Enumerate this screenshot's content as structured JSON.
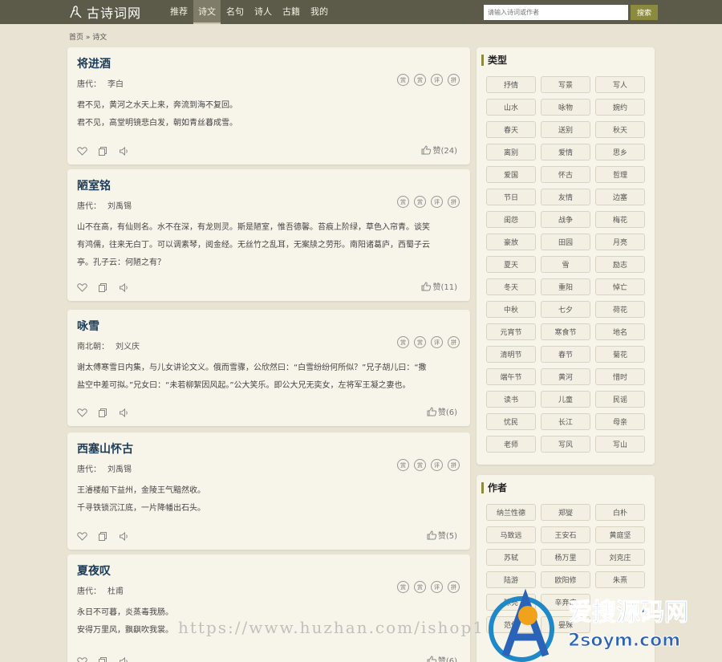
{
  "header": {
    "logo_text": "古诗词网",
    "nav": [
      "推荐",
      "诗文",
      "名句",
      "诗人",
      "古籍",
      "我的"
    ],
    "search_placeholder": "请输入诗词或作者",
    "search_button": "搜索"
  },
  "breadcrumb": {
    "home": "首页",
    "sep": "»",
    "current": "诗文"
  },
  "actions": [
    "赏",
    "赏",
    "评",
    "拼"
  ],
  "cards": [
    {
      "title": "将进酒",
      "dynasty": "唐代：",
      "author": "李白",
      "lines": [
        "君不见，黄河之水天上来，奔流到海不复回。",
        "君不见，高堂明镜悲白发，朝如青丝暮成雪。"
      ],
      "likes": "赞(24)"
    },
    {
      "title": "陋室铭",
      "dynasty": "唐代：",
      "author": "刘禹锡",
      "lines": [
        "山不在高，有仙则名。水不在深，有龙则灵。斯是陋室，惟吾德馨。苔痕上阶绿，草色入帘青。谈笑",
        "有鸿儒，往来无白丁。可以调素琴，阅金经。无丝竹之乱耳，无案牍之劳形。南阳诸葛庐，西蜀子云",
        "亭。孔子云：何陋之有？"
      ],
      "likes": "赞(11)"
    },
    {
      "title": "咏雪",
      "dynasty": "南北朝：",
      "author": "刘义庆",
      "lines": [
        "谢太傅寒雪日内集，与儿女讲论文义。俄而雪骤，公欣然曰：“白雪纷纷何所似？”兄子胡儿曰：“撒",
        "盐空中差可拟。”兄女曰：“未若柳絮因风起。”公大笑乐。即公大兄无奕女，左将军王凝之妻也。"
      ],
      "likes": "赞(6)"
    },
    {
      "title": "西塞山怀古",
      "dynasty": "唐代：",
      "author": "刘禹锡",
      "lines": [
        "王濬楼船下益州，金陵王气黯然收。",
        "千寻铁锁沉江底，一片降幡出石头。"
      ],
      "likes": "赞(5)"
    },
    {
      "title": "夏夜叹",
      "dynasty": "唐代：",
      "author": "杜甫",
      "lines": [
        "永日不可暮，炎蒸毒我肠。",
        "安得万里风，飘飖吹我裳。"
      ],
      "likes": "赞(6)"
    }
  ],
  "types_panel": {
    "title": "类型",
    "tags": [
      "抒情",
      "写景",
      "写人",
      "山水",
      "咏物",
      "婉约",
      "春天",
      "送别",
      "秋天",
      "离别",
      "爱情",
      "思乡",
      "爱国",
      "怀古",
      "哲理",
      "节日",
      "友情",
      "边塞",
      "闺怨",
      "战争",
      "梅花",
      "豪放",
      "田园",
      "月亮",
      "夏天",
      "雪",
      "励志",
      "冬天",
      "重阳",
      "悼亡",
      "中秋",
      "七夕",
      "荷花",
      "元宵节",
      "寒食节",
      "地名",
      "清明节",
      "春节",
      "菊花",
      "端午节",
      "黄河",
      "惜时",
      "读书",
      "儿童",
      "民谣",
      "忧民",
      "长江",
      "母亲",
      "老师",
      "写风",
      "写山"
    ]
  },
  "authors_panel": {
    "title": "作者",
    "tags": [
      "纳兰性德",
      "郑燮",
      "白朴",
      "马致远",
      "王安石",
      "黄庭坚",
      "苏轼",
      "杨万里",
      "刘克庄",
      "陆游",
      "欧阳修",
      "朱熹",
      "陈亮",
      "辛弃疾",
      "",
      "范仲",
      "晏殊",
      ""
    ]
  },
  "watermark": {
    "text": "https://www.huzhan.com/ishop1",
    "cn": "爱搜源码网",
    "url": "2soym.com"
  },
  "colors": {
    "topbar": "#5c5a48",
    "accent": "#8b8a3f",
    "title": "#1a3c5a",
    "bg": "#e8e3d2",
    "card": "#f7f4ea"
  }
}
